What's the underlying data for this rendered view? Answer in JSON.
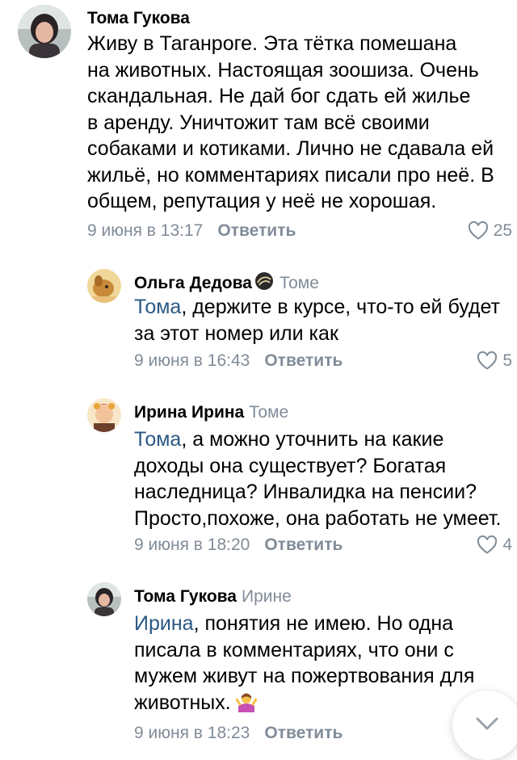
{
  "comments": [
    {
      "author": "Тома Гукова",
      "reply_to": "",
      "mention": "",
      "text": "Живу в Таганроге. Эта тётка помешана\nна животных. Настоящая зоошиза. Очень\nскандальная. Не дай бог сдать ей жилье\nв аренду. Уничтожит там всё своими\nсобаками и котиками. Лично не сдавала ей\nжильё, но комментариях писали про неё. В\nобщем, репутация у неё не хорошая.",
      "date": "9 июня в 13:17",
      "reply_label": "Ответить",
      "likes": "25",
      "avatar_icon": "woman-avatar"
    },
    {
      "author": "Ольга Дедова",
      "reply_to": "Томе",
      "mention": "Тома",
      "text": ", держите в курсе, что-то ей будет\nза этот номер или как",
      "date": "9 июня в 16:43",
      "reply_label": "Ответить",
      "likes": "5",
      "avatar_icon": "dog-avatar"
    },
    {
      "author": "Ирина Ирина",
      "reply_to": "Томе",
      "mention": "Тома",
      "text": ", а можно уточнить на какие\nдоходы она существует? Богатая\nнаследница? Инвалидка на пенсии?\nПросто,похоже, она  работать не умеет.",
      "date": "9 июня в 18:20",
      "reply_label": "Ответить",
      "likes": "4",
      "avatar_icon": "doll-avatar"
    },
    {
      "author": "Тома Гукова",
      "reply_to": "Ирине",
      "mention": "Ирина",
      "text": ", понятия не имею. Но одна\nписала в комментариях, что они с\nмужем живут на пожертвования для\nживотных.",
      "date": "9 июня в 18:23",
      "reply_label": "Ответить",
      "likes": "",
      "avatar_icon": "woman-avatar"
    }
  ],
  "colors": {
    "link": "#2a5885",
    "meta": "#818c99",
    "text": "#000000"
  },
  "icons": {
    "like": "heart-outline-icon",
    "verified": "verified-badge-icon",
    "shrug": "person-shrugging-emoji-icon",
    "scroll": "chevron-down-icon"
  }
}
